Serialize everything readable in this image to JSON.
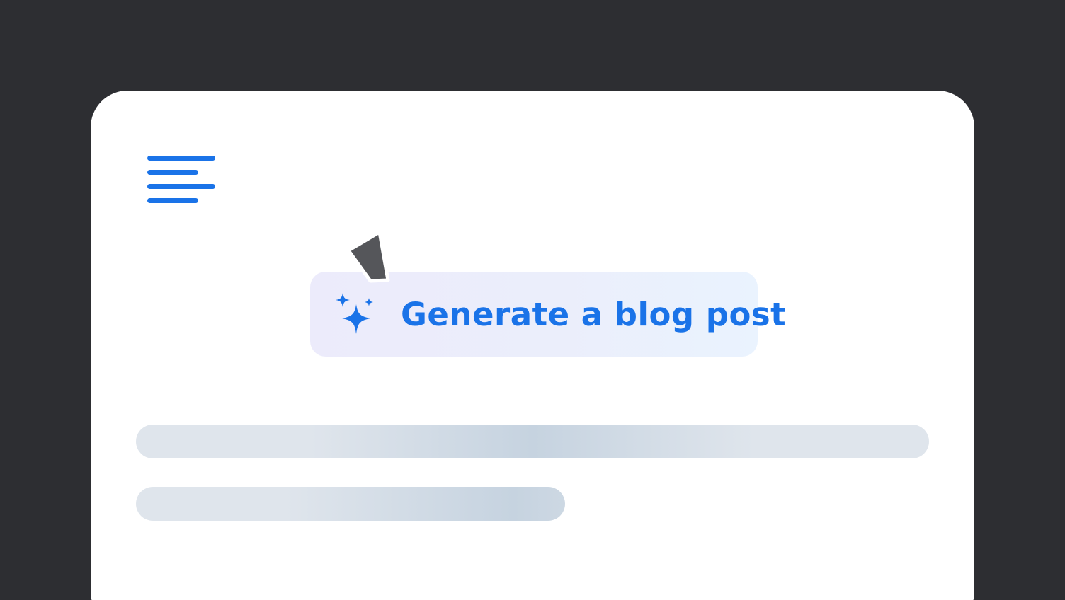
{
  "colors": {
    "background": "#2d2e32",
    "card": "#ffffff",
    "accent": "#1a73e8",
    "cursor": "#55565a",
    "skeleton": "#dfe5ec"
  },
  "menu": {
    "icon": "hamburger-menu-icon"
  },
  "generate_button": {
    "icon": "sparkle-icon",
    "label": "Generate a blog post"
  },
  "cursor": {
    "icon": "pointer-cursor-icon"
  },
  "content": {
    "state": "loading-skeleton"
  }
}
